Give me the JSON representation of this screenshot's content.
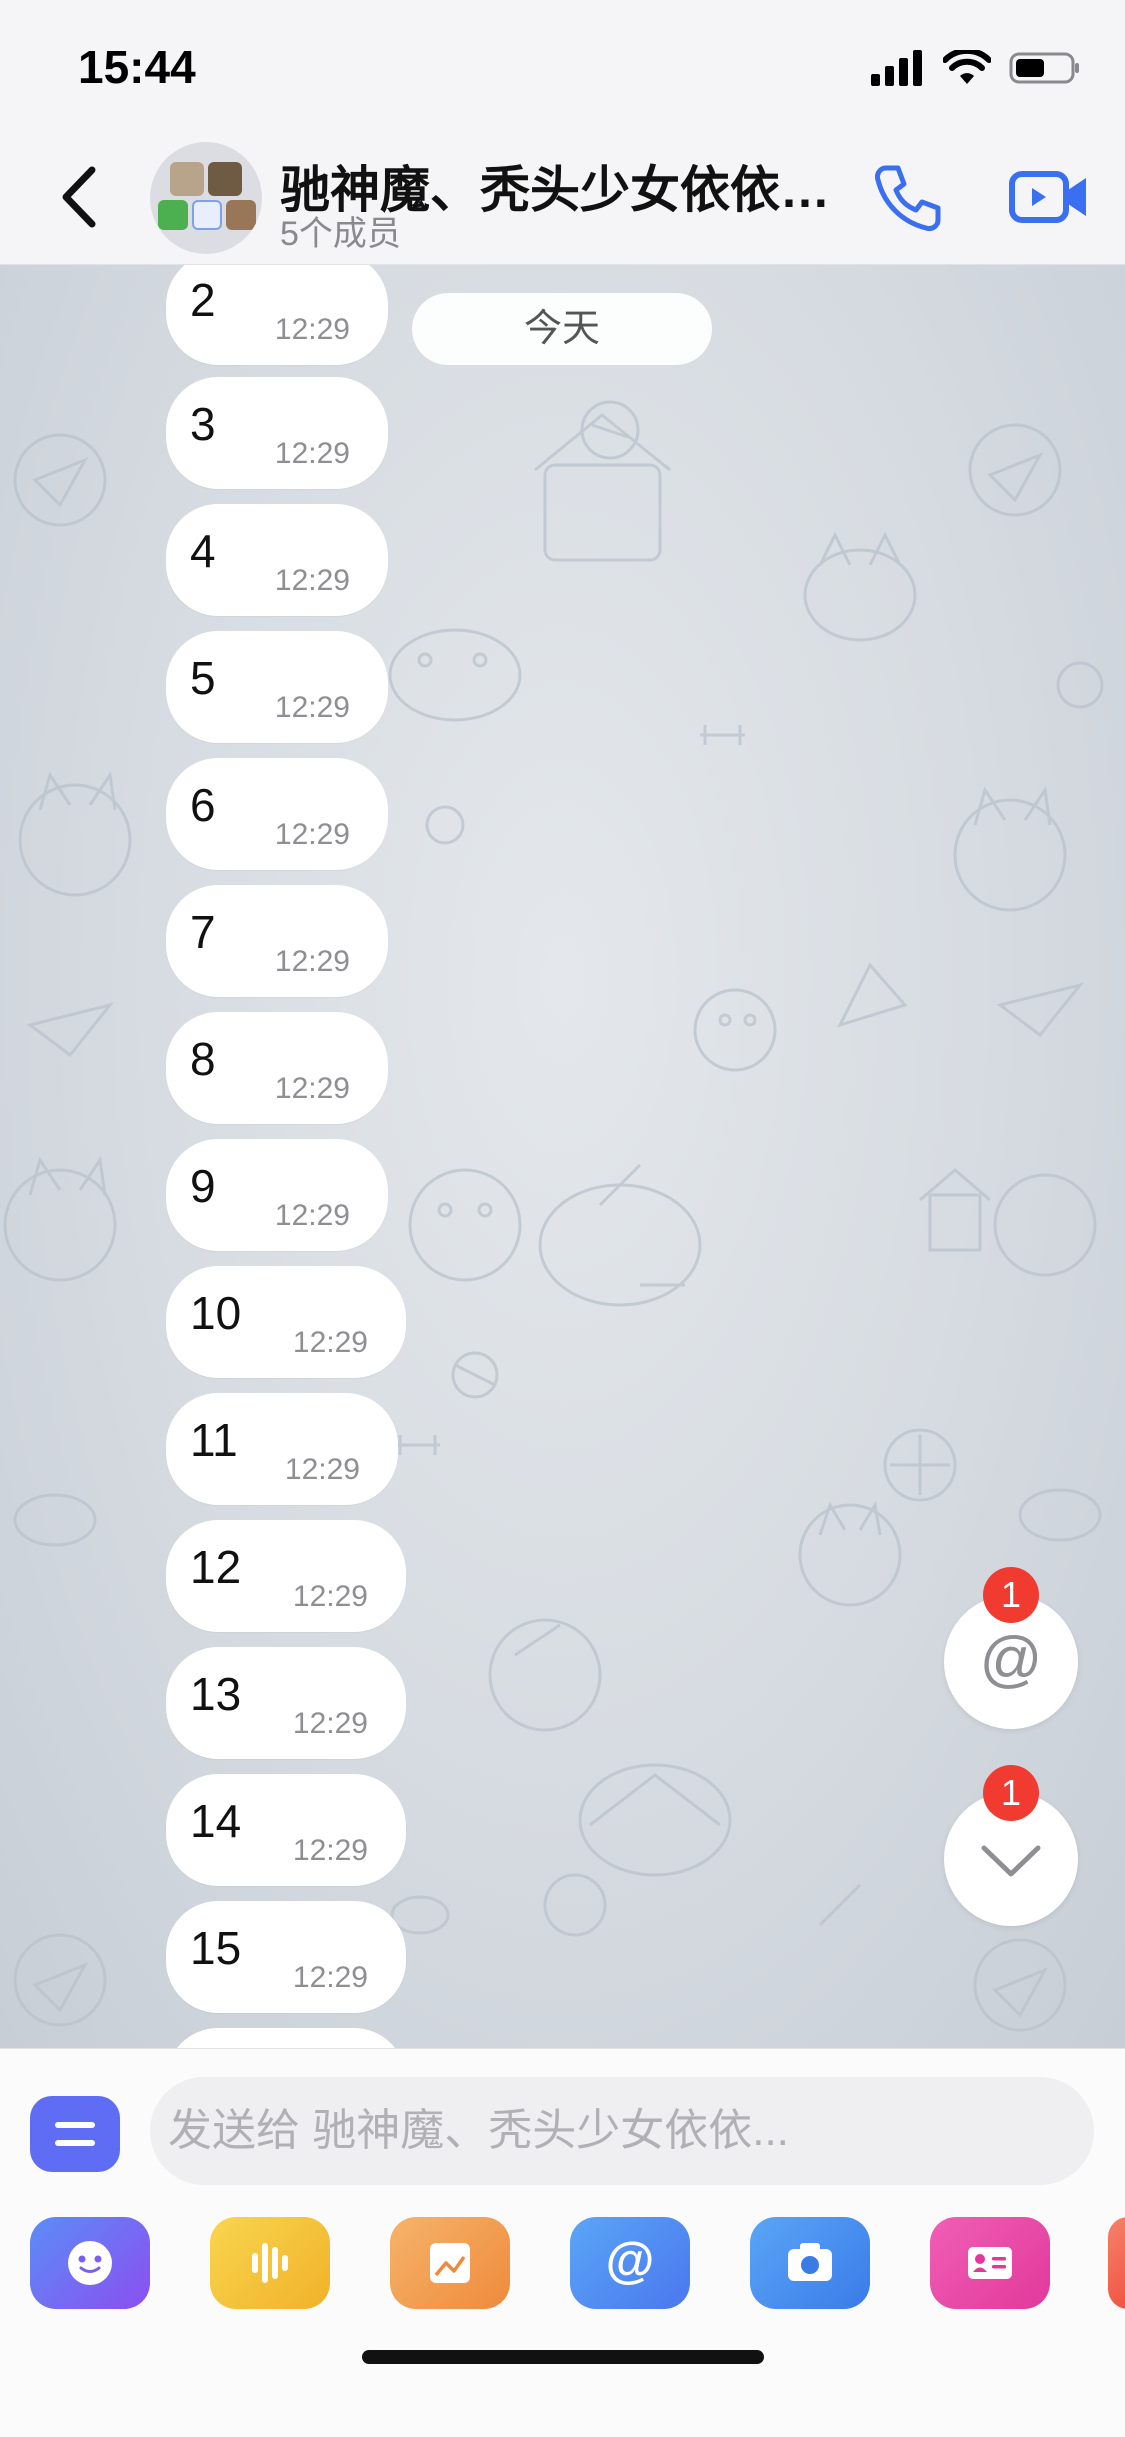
{
  "status_bar": {
    "time": "15:44"
  },
  "nav": {
    "title": "驰神魔、秃头少女依依…",
    "subtitle": "5个成员"
  },
  "chat": {
    "date_label": "今天",
    "messages": [
      {
        "text": "2",
        "time": "12:29"
      },
      {
        "text": "3",
        "time": "12:29"
      },
      {
        "text": "4",
        "time": "12:29"
      },
      {
        "text": "5",
        "time": "12:29"
      },
      {
        "text": "6",
        "time": "12:29"
      },
      {
        "text": "7",
        "time": "12:29"
      },
      {
        "text": "8",
        "time": "12:29"
      },
      {
        "text": "9",
        "time": "12:29"
      },
      {
        "text": "10",
        "time": "12:29"
      },
      {
        "text": "11",
        "time": "12:29"
      },
      {
        "text": "12",
        "time": "12:29"
      },
      {
        "text": "13",
        "time": "12:29"
      },
      {
        "text": "14",
        "time": "12:29"
      },
      {
        "text": "15",
        "time": "12:29"
      }
    ],
    "mention_button": {
      "symbol": "@",
      "badge": "1"
    },
    "scroll_down_button": {
      "badge": "1"
    }
  },
  "composer": {
    "placeholder": "发送给 驰神魔、秃头少女依依...",
    "toolbar": [
      "emoji-icon",
      "voice-icon",
      "image-icon",
      "mention-icon",
      "camera-icon",
      "contact-card-icon"
    ]
  },
  "colors": {
    "accent": "#3a6ff0",
    "badge": "#f23b30",
    "menu": "#5e6df3"
  }
}
